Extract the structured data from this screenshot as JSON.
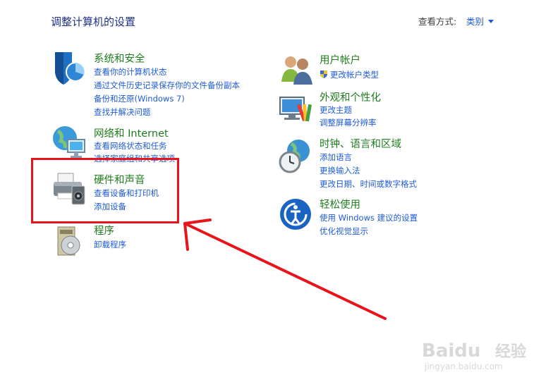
{
  "header": {
    "title": "调整计算机的设置",
    "view_by_label": "查看方式:",
    "view_by_value": "类别"
  },
  "categories": {
    "system": {
      "title": "系统和安全",
      "links": [
        "查看你的计算机状态",
        "通过文件历史记录保存你的文件备份副本",
        "备份和还原(Windows 7)",
        "查找并解决问题"
      ]
    },
    "network": {
      "title": "网络和 Internet",
      "links": [
        "查看网络状态和任务",
        "选择家庭组和共享选项"
      ]
    },
    "hardware": {
      "title": "硬件和声音",
      "links": [
        "查看设备和打印机",
        "添加设备"
      ]
    },
    "programs": {
      "title": "程序",
      "links": [
        "卸载程序"
      ]
    },
    "users": {
      "title": "用户帐户",
      "links": [
        "更改帐户类型"
      ]
    },
    "appearance": {
      "title": "外观和个性化",
      "links": [
        "更改主题",
        "调整屏幕分辨率"
      ]
    },
    "clock": {
      "title": "时钟、语言和区域",
      "links": [
        "添加语言",
        "更换输入法",
        "更改日期、时间或数字格式"
      ]
    },
    "ease": {
      "title": "轻松使用",
      "links": [
        "使用 Windows 建议的设置",
        "优化视觉显示"
      ]
    }
  },
  "watermark": {
    "brand": "Baidu",
    "brand_suffix": "经验",
    "url": "jingyan.baidu.com"
  },
  "colors": {
    "category_title": "#1f7d1f",
    "link": "#1e5bd6",
    "annotation": "#e8141b",
    "page_title": "#1e3287"
  }
}
